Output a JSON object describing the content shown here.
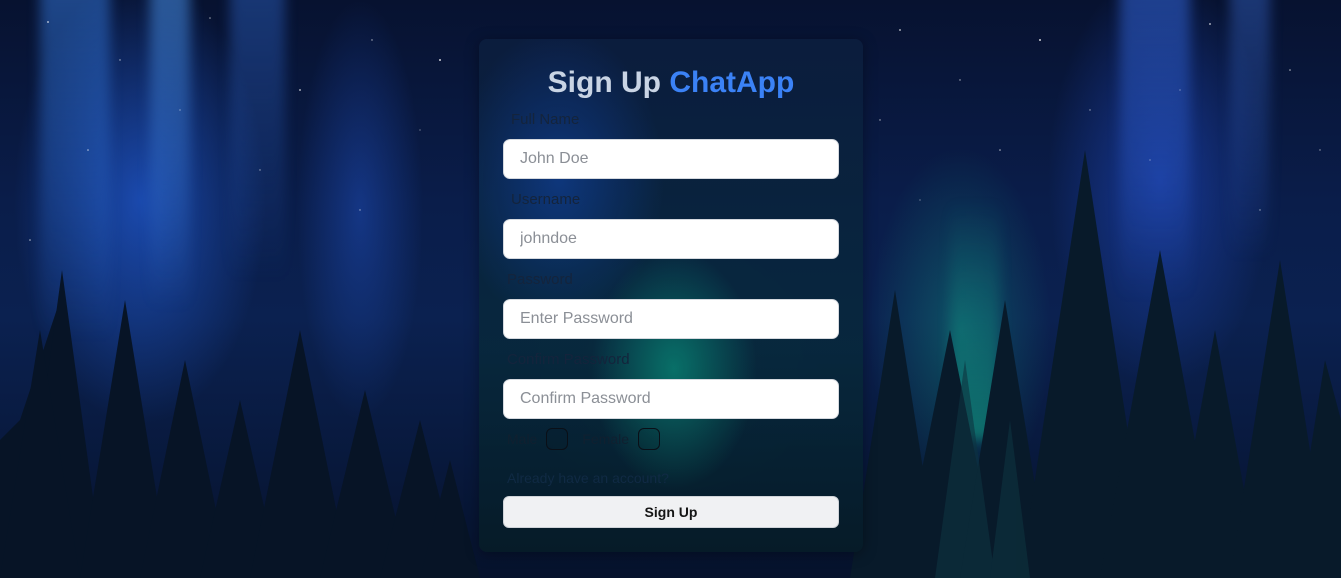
{
  "form": {
    "title_prefix": "Sign Up",
    "title_brand": "ChatApp",
    "fields": [
      {
        "label": "Full Name",
        "placeholder": "John Doe",
        "value": ""
      },
      {
        "label": "Username",
        "placeholder": "johndoe",
        "value": ""
      },
      {
        "label": "Password",
        "placeholder": "Enter Password",
        "value": ""
      },
      {
        "label": "Confirm Password",
        "placeholder": "Confirm Password",
        "value": ""
      }
    ],
    "gender": {
      "male_label": "Male",
      "female_label": "Female",
      "male_checked": false,
      "female_checked": false
    },
    "login_link": "Already have an account?",
    "submit_label": "Sign Up"
  },
  "theme": {
    "brand_color": "#3b82f6",
    "button_bg": "#f0f1f3",
    "input_bg": "#ffffff"
  }
}
